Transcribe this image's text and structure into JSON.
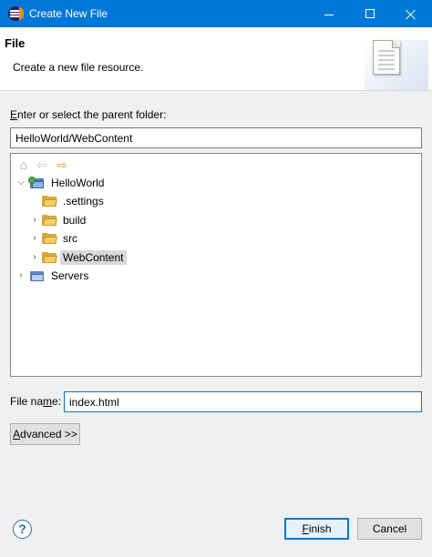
{
  "window": {
    "title": "Create New File",
    "accent": "#0078d7"
  },
  "header": {
    "title": "File",
    "description": "Create a new file resource.",
    "banner_icon": "new-file-wizard-icon"
  },
  "parent_folder": {
    "label_prefix": "E",
    "label_rest": "nter or select the parent folder:",
    "value": "HelloWorld/WebContent"
  },
  "tree_toolbar": {
    "icons": [
      "home-icon",
      "back-arrow-icon",
      "forward-arrow-icon"
    ]
  },
  "tree": {
    "items": [
      {
        "label": "HelloWorld",
        "level": 0,
        "expanded": true,
        "icon": "web-project-icon",
        "twisty": "expanded"
      },
      {
        "label": ".settings",
        "level": 1,
        "icon": "folder-icon",
        "twisty": "none"
      },
      {
        "label": "build",
        "level": 1,
        "icon": "folder-icon",
        "twisty": "collapsed"
      },
      {
        "label": "src",
        "level": 1,
        "icon": "folder-icon",
        "twisty": "collapsed"
      },
      {
        "label": "WebContent",
        "level": 1,
        "icon": "folder-icon",
        "twisty": "collapsed",
        "selected": true
      },
      {
        "label": "Servers",
        "level": 0,
        "icon": "servers-project-icon",
        "twisty": "collapsed"
      }
    ]
  },
  "file_name": {
    "label_before": "File na",
    "label_mnemonic": "m",
    "label_after": "e:",
    "value": "index.html"
  },
  "advanced": {
    "label_mnemonic": "A",
    "label_rest": "dvanced >>"
  },
  "buttons": {
    "finish_mnemonic": "F",
    "finish_rest": "inish",
    "cancel": "Cancel",
    "help": "?"
  }
}
